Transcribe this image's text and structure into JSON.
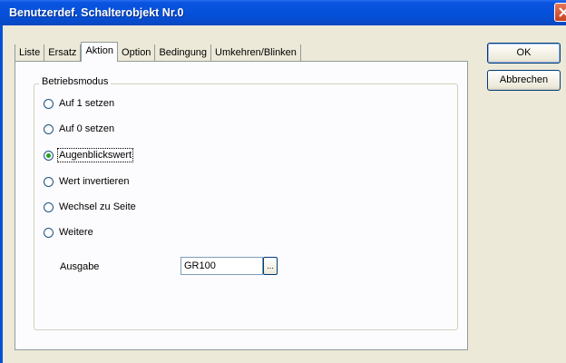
{
  "window": {
    "title": "Benutzerdef. Schalterobjekt Nr.0"
  },
  "tabs": [
    {
      "label": "Liste",
      "active": false
    },
    {
      "label": "Ersatz",
      "active": false
    },
    {
      "label": "Aktion",
      "active": true
    },
    {
      "label": "Option",
      "active": false
    },
    {
      "label": "Bedingung",
      "active": false
    },
    {
      "label": "Umkehren/Blinken",
      "active": false
    }
  ],
  "group": {
    "label": "Betriebsmodus",
    "options": [
      {
        "label": "Auf 1 setzen",
        "selected": false
      },
      {
        "label": "Auf 0 setzen",
        "selected": false
      },
      {
        "label": "Augenblickswert",
        "selected": true
      },
      {
        "label": "Wert invertieren",
        "selected": false
      },
      {
        "label": "Wechsel zu Seite",
        "selected": false
      },
      {
        "label": "Weitere",
        "selected": false
      }
    ]
  },
  "ausgabe": {
    "label": "Ausgabe",
    "value": "GR100",
    "browse_label": "..."
  },
  "buttons": {
    "ok": "OK",
    "cancel": "Abbrechen"
  },
  "colors": {
    "titlebar": "#0550d8",
    "dialog_bg": "#ece9d8",
    "panel_bg": "#fcfcfe",
    "radio_selected": "#21a121"
  }
}
